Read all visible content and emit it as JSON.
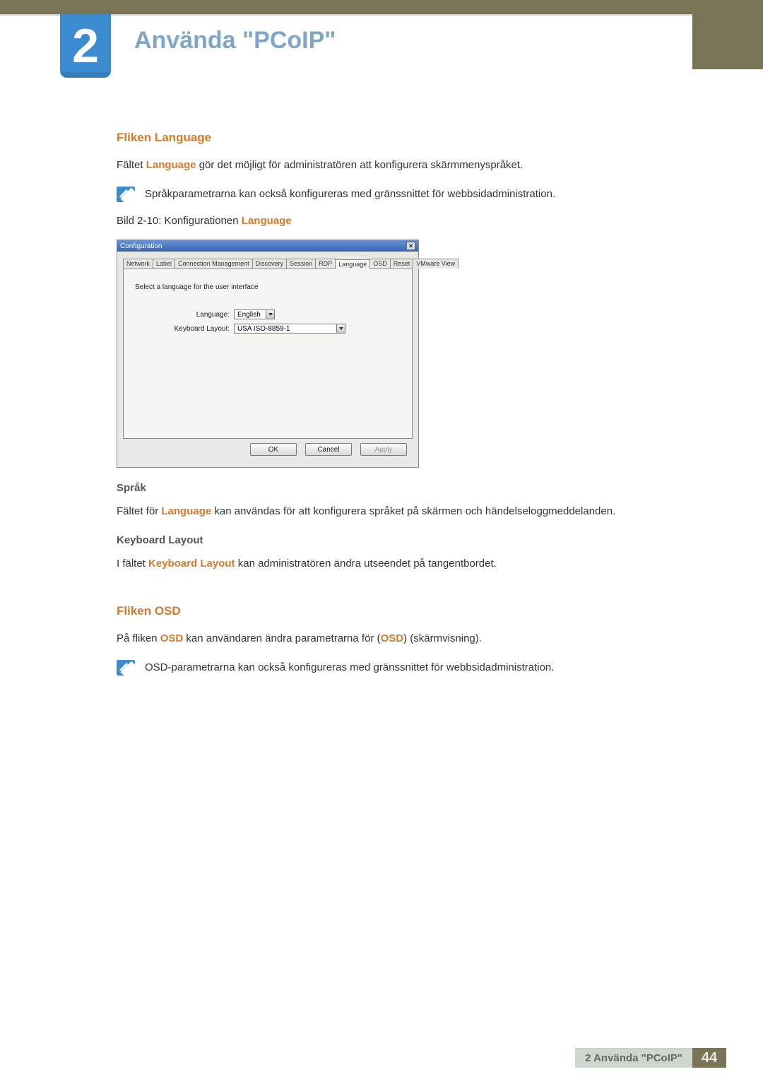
{
  "chapter": {
    "number": "2",
    "title": "Använda \"PCoIP\""
  },
  "section1": {
    "heading": "Fliken Language",
    "para1_pre": "Fältet ",
    "para1_em": "Language",
    "para1_post": " gör det möjligt för administratören att konfigurera skärmmenyspråket.",
    "note": "Språkparametrarna kan också konfigureras med gränssnittet för webbsidadministration.",
    "fig_label_pre": "Bild 2-10: Konfigurationen ",
    "fig_label_em": "Language"
  },
  "dialog": {
    "title": "Configuration",
    "close_glyph": "✕",
    "tabs": [
      "Network",
      "Label",
      "Connection Management",
      "Discovery",
      "Session",
      "RDP",
      "Language",
      "OSD",
      "Reset",
      "VMware View"
    ],
    "active_tab_index": 6,
    "panel_text": "Select a language for the user interface",
    "lang_label": "Language:",
    "lang_value": "English",
    "kb_label": "Keyboard Layout:",
    "kb_value": "USA ISO-8859-1",
    "btn_ok": "OK",
    "btn_cancel": "Cancel",
    "btn_apply": "Apply"
  },
  "section2": {
    "sub1_heading": "Språk",
    "sub1_pre": "Fältet för ",
    "sub1_em": "Language",
    "sub1_post": " kan användas för att konfigurera språket på skärmen och händelseloggmeddelanden.",
    "sub2_heading": "Keyboard Layout",
    "sub2_pre": "I fältet ",
    "sub2_em": "Keyboard Layout",
    "sub2_post": " kan administratören ändra utseendet på tangentbordet."
  },
  "section3": {
    "heading": "Fliken OSD",
    "para_pre": "På fliken ",
    "para_em1": "OSD",
    "para_mid": " kan användaren ändra parametrarna för (",
    "para_em2": "OSD",
    "para_post": ") (skärmvisning).",
    "note": "OSD-parametrarna kan också konfigureras med gränssnittet för webbsidadministration."
  },
  "footer": {
    "label": "2 Använda \"PCoIP\"",
    "page": "44"
  }
}
